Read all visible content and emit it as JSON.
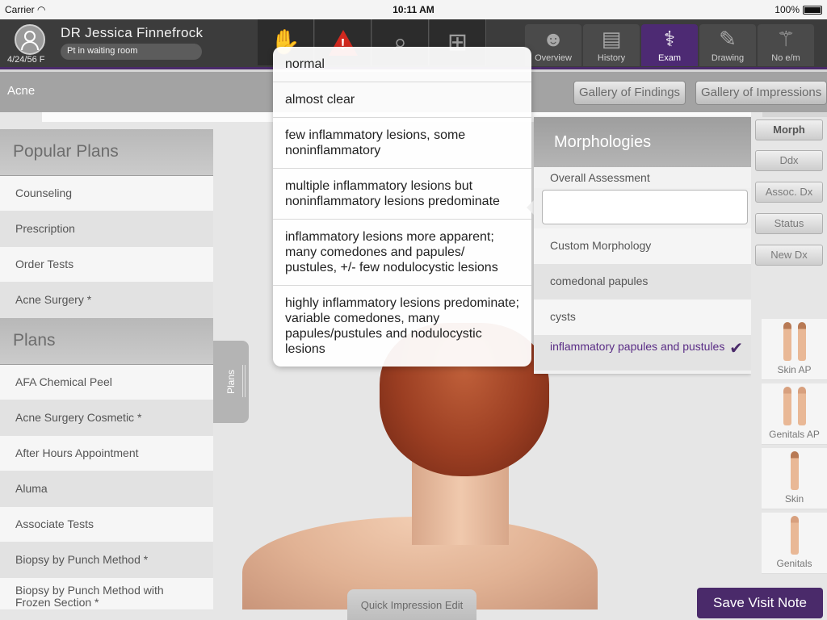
{
  "status_bar": {
    "carrier": "Carrier",
    "time": "10:11 AM",
    "battery": "100%"
  },
  "patient": {
    "name": "DR Jessica  Finnefrock",
    "dob": "4/24/56 F",
    "status": "Pt in waiting room"
  },
  "toolbar": {
    "tools": [
      "hand-icon",
      "warning-icon",
      "search-icon",
      "flowchart-icon"
    ]
  },
  "nav": {
    "tabs": [
      {
        "label": "Overview",
        "icon": "head-icon"
      },
      {
        "label": "History",
        "icon": "book-icon"
      },
      {
        "label": "Exam",
        "icon": "stethoscope-icon",
        "active": true
      },
      {
        "label": "Drawing",
        "icon": "palette-icon"
      },
      {
        "label": "No e/m",
        "icon": "em-icon"
      }
    ]
  },
  "subheader": {
    "diagnosis": "Acne",
    "gallery_findings": "Gallery of Findings",
    "gallery_impressions": "Gallery of Impressions"
  },
  "left_panel": {
    "popular_title": "Popular Plans",
    "popular": [
      "Counseling",
      "Prescription",
      "Order Tests",
      "Acne Surgery *"
    ],
    "plans_title": "Plans",
    "plans": [
      "AFA Chemical Peel",
      "Acne Surgery Cosmetic *",
      "After Hours Appointment",
      "Aluma",
      "Associate Tests",
      "Biopsy by Punch Method *",
      "Biopsy by Punch Method with Frozen Section *"
    ],
    "tab_label": "Plans"
  },
  "popover": {
    "options": [
      "normal",
      "almost clear",
      "few inflammatory lesions, some noninflammatory",
      "multiple inflammatory lesions but noninflammatory lesions predominate",
      "inflammatory lesions more apparent; many comedones and papules/ pustules, +/- few nodulocystic lesions",
      "highly inflammatory lesions predominate; variable comedones, many papules/pustules and nodulocystic lesions"
    ]
  },
  "morph": {
    "title": "Morphologies",
    "overall_label": "Overall Assessment",
    "overall_value": "",
    "custom_label": "Custom Morphology",
    "items": [
      "comedonal papules",
      "cysts",
      "inflammatory papules and pustules"
    ],
    "selected": "inflammatory papules and pustules"
  },
  "right_rail": {
    "buttons": [
      "Morph",
      "Ddx",
      "Assoc. Dx",
      "Status",
      "New Dx"
    ],
    "thumbs": [
      "Skin AP",
      "Genitals AP",
      "Skin",
      "Genitals"
    ]
  },
  "footer": {
    "quick_edit": "Quick Impression Edit",
    "save": "Save Visit Note"
  },
  "colors": {
    "accent": "#4a2a6a",
    "header": "#3c3c3c",
    "active_tab": "#4d2a73"
  }
}
